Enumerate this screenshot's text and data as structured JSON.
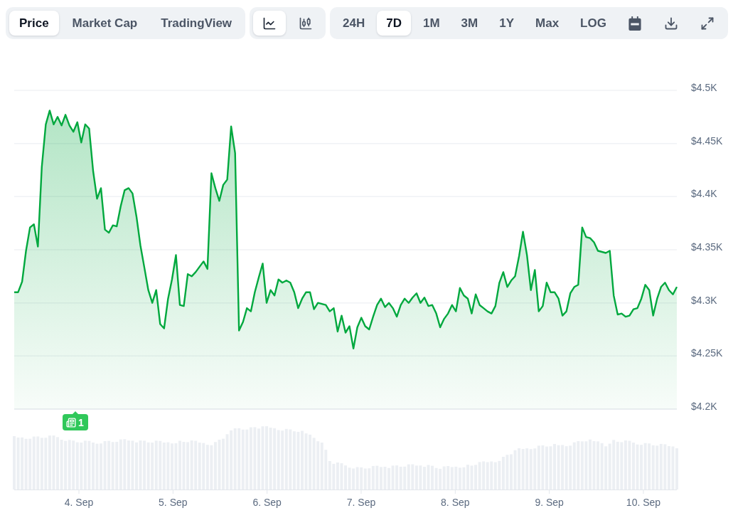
{
  "toolbar": {
    "view_tabs": [
      {
        "label": "Price",
        "selected": true
      },
      {
        "label": "Market Cap",
        "selected": false
      },
      {
        "label": "TradingView",
        "selected": false
      }
    ],
    "chart_types": [
      {
        "kind": "line",
        "selected": true
      },
      {
        "kind": "candlestick",
        "selected": false
      }
    ],
    "ranges": [
      {
        "label": "24H",
        "selected": false
      },
      {
        "label": "7D",
        "selected": true
      },
      {
        "label": "1M",
        "selected": false
      },
      {
        "label": "3M",
        "selected": false
      },
      {
        "label": "1Y",
        "selected": false
      },
      {
        "label": "Max",
        "selected": false
      }
    ],
    "log_toggle": {
      "label": "LOG",
      "on": false
    },
    "actions": [
      {
        "kind": "calendar"
      },
      {
        "kind": "download"
      },
      {
        "kind": "fullscreen"
      }
    ]
  },
  "chart": {
    "chart_data": {
      "type": "area",
      "grid": true,
      "ylim": [
        4200,
        4500
      ],
      "yticks": [
        {
          "value": 4200,
          "label": "$4.2K"
        },
        {
          "value": 4250,
          "label": "$4.25K"
        },
        {
          "value": 4300,
          "label": "$4.3K"
        },
        {
          "value": 4350,
          "label": "$4.35K"
        },
        {
          "value": 4400,
          "label": "$4.4K"
        },
        {
          "value": 4450,
          "label": "$4.45K"
        },
        {
          "value": 4500,
          "label": "$4.5K"
        }
      ],
      "series": [
        {
          "color": "#00a83e",
          "values": [
            4310,
            4310,
            4320,
            4349,
            4371,
            4374,
            4353,
            4428,
            4468,
            4481,
            4468,
            4475,
            4467,
            4477,
            4467,
            4461,
            4470,
            4451,
            4468,
            4464,
            4424,
            4398,
            4408,
            4369,
            4366,
            4373,
            4372,
            4391,
            4406,
            4408,
            4403,
            4381,
            4354,
            4333,
            4312,
            4300,
            4312,
            4280,
            4276,
            4304,
            4322,
            4345,
            4298,
            4297,
            4327,
            4325,
            4329,
            4334,
            4339,
            4332,
            4422,
            4408,
            4396,
            4411,
            4416,
            4466,
            4441,
            4274,
            4282,
            4295,
            4292,
            4310,
            4324,
            4337,
            4300,
            4312,
            4307,
            4322,
            4319,
            4321,
            4319,
            4310,
            4295,
            4304,
            4310,
            4310,
            4294,
            4300,
            4299,
            4298,
            4292,
            4295,
            4273,
            4288,
            4272,
            4278,
            4257,
            4277,
            4286,
            4278,
            4275,
            4287,
            4298,
            4304,
            4296,
            4300,
            4295,
            4287,
            4298,
            4304,
            4300,
            4305,
            4309,
            4300,
            4305,
            4297,
            4298,
            4290,
            4277,
            4285,
            4290,
            4298,
            4292,
            4314,
            4307,
            4304,
            4290,
            4308,
            4298,
            4295,
            4292,
            4290,
            4297,
            4319,
            4329,
            4315,
            4321,
            4325,
            4344,
            4367,
            4345,
            4312,
            4331,
            4292,
            4297,
            4319,
            4310,
            4310,
            4304,
            4288,
            4292,
            4309,
            4315,
            4317,
            4371,
            4362,
            4361,
            4357,
            4349,
            4348,
            4347,
            4349,
            4307,
            4289,
            4290,
            4287,
            4288,
            4294,
            4295,
            4304,
            4317,
            4312,
            4288,
            4304,
            4315,
            4319,
            4312,
            4308,
            4315
          ]
        }
      ]
    },
    "time_axis": [
      "4. Sep",
      "5. Sep",
      "6. Sep",
      "7. Sep",
      "8. Sep",
      "9. Sep",
      "10. Sep"
    ],
    "news_marker": {
      "count": "1"
    }
  }
}
